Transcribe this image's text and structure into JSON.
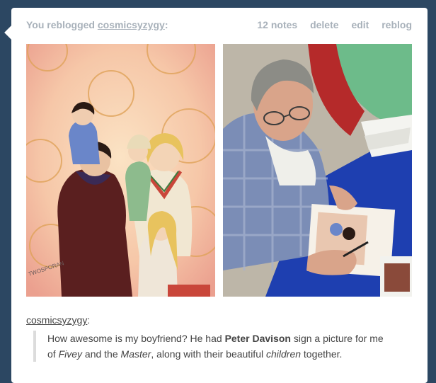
{
  "header": {
    "prefix": "You reblogged",
    "username": "cosmicsyzygy",
    "suffix": ":",
    "notes": "12 notes",
    "delete_label": "delete",
    "edit_label": "edit",
    "reblog_label": "reblog"
  },
  "caption": {
    "username": "cosmicsyzygy",
    "suffix": ":",
    "line1_a": "How awesome is my boyfriend? He had ",
    "line1_b": "Peter Davison",
    "line1_c": " sign a picture for me",
    "line2_a": "of ",
    "line2_b": "Fivey",
    "line2_c": " and the ",
    "line2_d": "Master",
    "line2_e": ", along with their beautiful ",
    "line2_f": "children",
    "line2_g": " together."
  },
  "artwork": {
    "signature": "TWOSPORAN"
  },
  "colors": {
    "background": "#2c4762",
    "card": "#ffffff",
    "header_text": "#a8b1ba",
    "body_text": "#444444"
  }
}
